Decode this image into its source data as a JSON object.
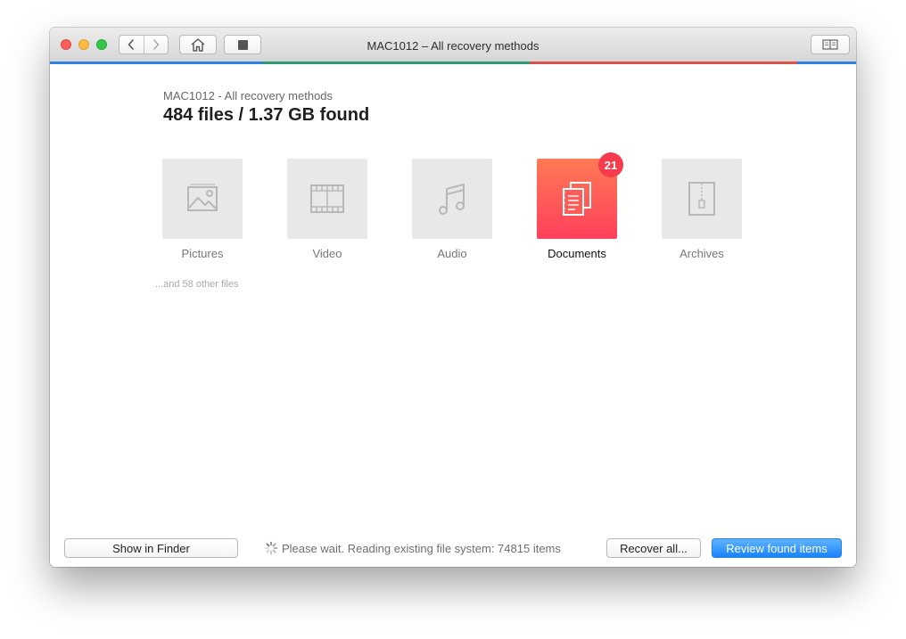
{
  "window": {
    "title": "MAC1012 – All recovery methods",
    "accent_colors": [
      "#2f7fdc",
      "#2f9a76",
      "#2f7fdc",
      "#d9534a",
      "#2f7fdc"
    ]
  },
  "toolbar": {
    "back_icon": "chevron-left-icon",
    "forward_icon": "chevron-right-icon",
    "home_icon": "home-icon",
    "stop_icon": "stop-icon",
    "sidebar_icon": "book-sidebar-icon"
  },
  "header": {
    "subtitle": "MAC1012 - All recovery methods",
    "summary": "484 files / 1.37 GB found"
  },
  "categories": [
    {
      "label": "Pictures",
      "icon": "picture-icon",
      "active": false
    },
    {
      "label": "Video",
      "icon": "film-icon",
      "active": false
    },
    {
      "label": "Audio",
      "icon": "music-note-icon",
      "active": false
    },
    {
      "label": "Documents",
      "icon": "documents-icon",
      "active": true,
      "badge": "21"
    },
    {
      "label": "Archives",
      "icon": "archive-zip-icon",
      "active": false
    }
  ],
  "other_files": "...and 58 other files",
  "footer": {
    "show_in_finder": "Show in Finder",
    "status": "Please wait. Reading existing file system: 74815 items",
    "recover_all": "Recover all...",
    "review": "Review found items"
  },
  "colors": {
    "active_tile_gradient": [
      "#ff7a55",
      "#ff3f5b"
    ],
    "badge": "#f63c4c",
    "primary_button": "#1a82fb"
  }
}
